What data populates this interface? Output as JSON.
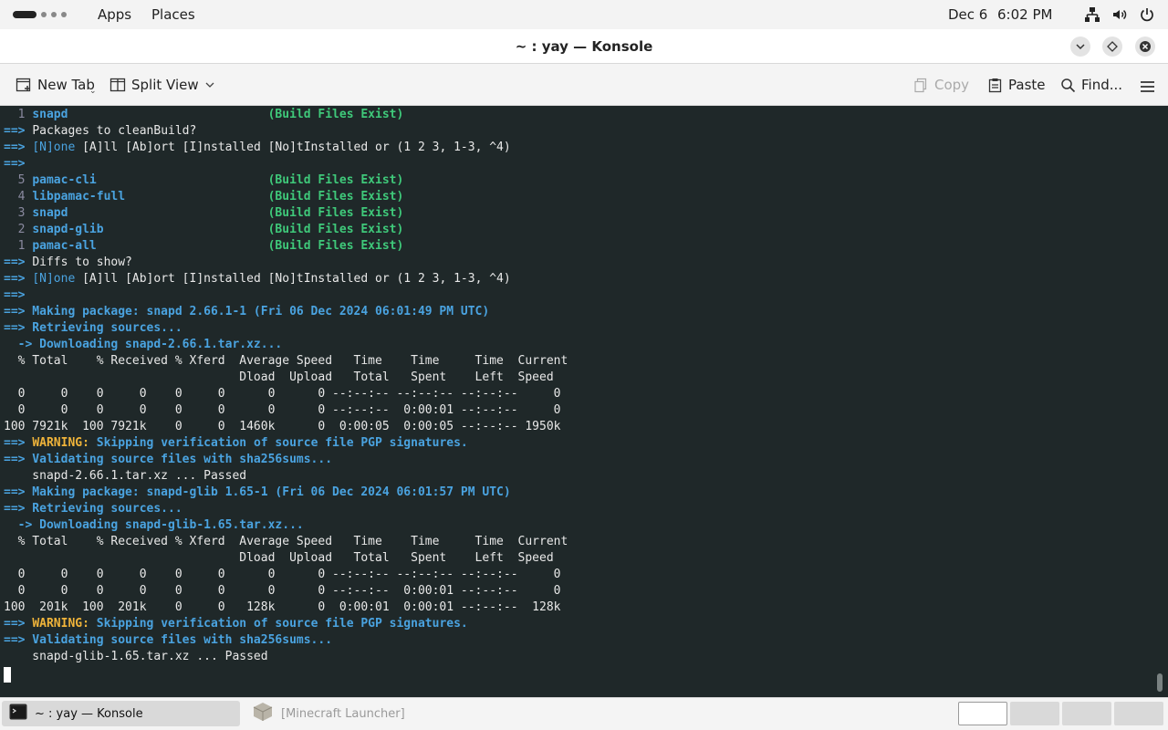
{
  "topbar": {
    "apps": "Apps",
    "places": "Places",
    "date": "Dec 6",
    "time": "6:02 PM",
    "tray_icons": [
      "network-icon",
      "volume-icon",
      "power-icon"
    ]
  },
  "window": {
    "title": "~ : yay — Konsole"
  },
  "toolbar": {
    "new_tab": "New Tab",
    "split_view": "Split View",
    "copy": "Copy",
    "paste": "Paste",
    "find": "Find..."
  },
  "terminal": {
    "lines": [
      [
        {
          "t": "  1 ",
          "c": "c-num"
        },
        {
          "t": "snapd",
          "c": "c-pkg"
        },
        {
          "t": "                            "
        },
        {
          "t": "(Build Files Exist)",
          "c": "c-exist"
        }
      ],
      [
        {
          "t": "==> ",
          "c": "c-arrow"
        },
        {
          "t": "Packages to cleanBuild?"
        }
      ],
      [
        {
          "t": "==> ",
          "c": "c-arrow"
        },
        {
          "t": "[N]one",
          "c": "c-none"
        },
        {
          "t": " [A]ll [Ab]ort [I]nstalled [No]tInstalled or (1 2 3, 1-3, ^4)"
        }
      ],
      [
        {
          "t": "==>",
          "c": "c-arrow"
        }
      ],
      [
        {
          "t": "  5 ",
          "c": "c-num"
        },
        {
          "t": "pamac-cli",
          "c": "c-pkg"
        },
        {
          "t": "                        "
        },
        {
          "t": "(Build Files Exist)",
          "c": "c-exist"
        }
      ],
      [
        {
          "t": "  4 ",
          "c": "c-num"
        },
        {
          "t": "libpamac-full",
          "c": "c-pkg"
        },
        {
          "t": "                    "
        },
        {
          "t": "(Build Files Exist)",
          "c": "c-exist"
        }
      ],
      [
        {
          "t": "  3 ",
          "c": "c-num"
        },
        {
          "t": "snapd",
          "c": "c-pkg"
        },
        {
          "t": "                            "
        },
        {
          "t": "(Build Files Exist)",
          "c": "c-exist"
        }
      ],
      [
        {
          "t": "  2 ",
          "c": "c-num"
        },
        {
          "t": "snapd-glib",
          "c": "c-pkg"
        },
        {
          "t": "                       "
        },
        {
          "t": "(Build Files Exist)",
          "c": "c-exist"
        }
      ],
      [
        {
          "t": "  1 ",
          "c": "c-num"
        },
        {
          "t": "pamac-all",
          "c": "c-pkg"
        },
        {
          "t": "                        "
        },
        {
          "t": "(Build Files Exist)",
          "c": "c-exist"
        }
      ],
      [
        {
          "t": "==> ",
          "c": "c-arrow"
        },
        {
          "t": "Diffs to show?"
        }
      ],
      [
        {
          "t": "==> ",
          "c": "c-arrow"
        },
        {
          "t": "[N]one",
          "c": "c-none"
        },
        {
          "t": " [A]ll [Ab]ort [I]nstalled [No]tInstalled or (1 2 3, 1-3, ^4)"
        }
      ],
      [
        {
          "t": "==>",
          "c": "c-arrow"
        }
      ],
      [
        {
          "t": "==> Making package: snapd 2.66.1-1 (Fri 06 Dec 2024 06:01:49 PM UTC)",
          "c": "c-blue-b"
        }
      ],
      [
        {
          "t": "==> Retrieving sources...",
          "c": "c-blue-b"
        }
      ],
      [
        {
          "t": "  -> Downloading snapd-2.66.1.tar.xz...",
          "c": "c-blue-b"
        }
      ],
      [
        {
          "t": "  % Total    % Received % Xferd  Average Speed   Time    Time     Time  Current"
        }
      ],
      [
        {
          "t": "                                 Dload  Upload   Total   Spent    Left  Speed"
        }
      ],
      [
        {
          "t": "  0     0    0     0    0     0      0      0 --:--:-- --:--:-- --:--:--     0"
        }
      ],
      [
        {
          "t": "  0     0    0     0    0     0      0      0 --:--:--  0:00:01 --:--:--     0"
        }
      ],
      [
        {
          "t": "100 7921k  100 7921k    0     0  1460k      0  0:00:05  0:00:05 --:--:-- 1950k"
        }
      ],
      [
        {
          "t": "==> ",
          "c": "c-blue-b"
        },
        {
          "t": "WARNING:",
          "c": "c-warn"
        },
        {
          "t": " Skipping verification of source file PGP signatures.",
          "c": "c-blue-b"
        }
      ],
      [
        {
          "t": "==> Validating source files with sha256sums...",
          "c": "c-blue-b"
        }
      ],
      [
        {
          "t": "    snapd-2.66.1.tar.xz ... Passed"
        }
      ],
      [
        {
          "t": "==> Making package: snapd-glib 1.65-1 (Fri 06 Dec 2024 06:01:57 PM UTC)",
          "c": "c-blue-b"
        }
      ],
      [
        {
          "t": "==> Retrieving sources...",
          "c": "c-blue-b"
        }
      ],
      [
        {
          "t": "  -> Downloading snapd-glib-1.65.tar.xz...",
          "c": "c-blue-b"
        }
      ],
      [
        {
          "t": "  % Total    % Received % Xferd  Average Speed   Time    Time     Time  Current"
        }
      ],
      [
        {
          "t": "                                 Dload  Upload   Total   Spent    Left  Speed"
        }
      ],
      [
        {
          "t": "  0     0    0     0    0     0      0      0 --:--:-- --:--:-- --:--:--     0"
        }
      ],
      [
        {
          "t": "  0     0    0     0    0     0      0      0 --:--:--  0:00:01 --:--:--     0"
        }
      ],
      [
        {
          "t": "100  201k  100  201k    0     0   128k      0  0:00:01  0:00:01 --:--:--  128k"
        }
      ],
      [
        {
          "t": "==> ",
          "c": "c-blue-b"
        },
        {
          "t": "WARNING:",
          "c": "c-warn"
        },
        {
          "t": " Skipping verification of source file PGP signatures.",
          "c": "c-blue-b"
        }
      ],
      [
        {
          "t": "==> Validating source files with sha256sums...",
          "c": "c-blue-b"
        }
      ],
      [
        {
          "t": "    snapd-glib-1.65.tar.xz ... Passed"
        }
      ]
    ]
  },
  "taskbar": {
    "tasks": [
      {
        "label": "~ : yay — Konsole",
        "active": true
      },
      {
        "label": "[Minecraft Launcher]",
        "active": false
      }
    ],
    "workspaces": 4
  }
}
